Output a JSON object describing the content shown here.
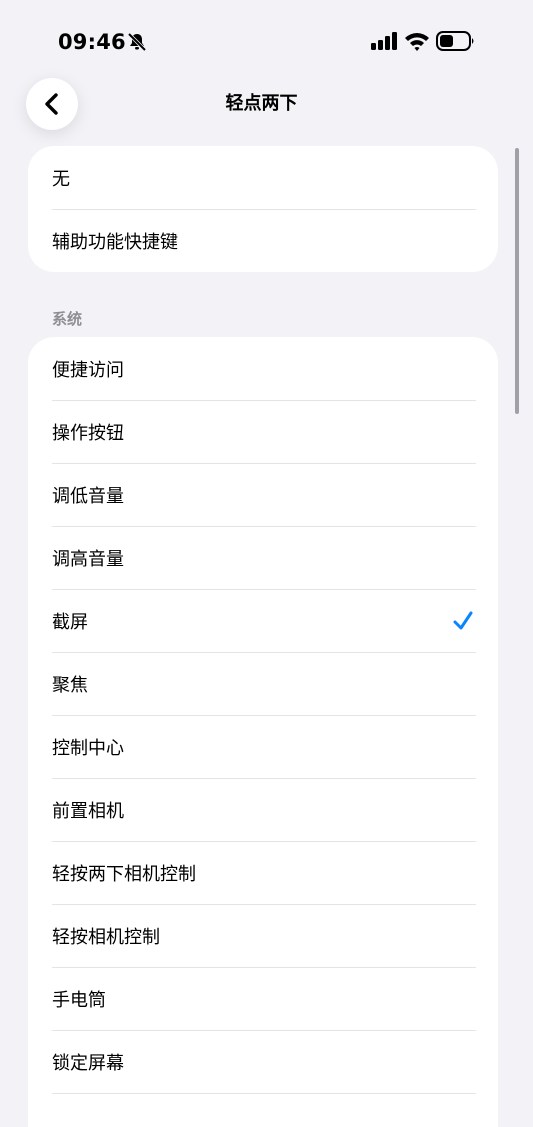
{
  "status_bar": {
    "time": "09:46",
    "icons": [
      "bell-slash-icon",
      "signal-icon",
      "wifi-icon",
      "battery-icon"
    ]
  },
  "nav": {
    "back_icon": "chevron-left-icon",
    "title": "轻点两下"
  },
  "top_group": {
    "items": [
      {
        "label": "无"
      },
      {
        "label": "辅助功能快捷键"
      }
    ]
  },
  "system_section": {
    "header": "系统",
    "items": [
      {
        "label": "便捷访问"
      },
      {
        "label": "操作按钮"
      },
      {
        "label": "调低音量"
      },
      {
        "label": "调高音量"
      },
      {
        "label": "截屏",
        "selected": true
      },
      {
        "label": "聚焦"
      },
      {
        "label": "控制中心"
      },
      {
        "label": "前置相机"
      },
      {
        "label": "轻按两下相机控制"
      },
      {
        "label": "轻按相机控制"
      },
      {
        "label": "手电筒"
      },
      {
        "label": "锁定屏幕"
      },
      {
        "label": ""
      }
    ]
  },
  "colors": {
    "background": "#f2f2f7",
    "card": "#ffffff",
    "accent": "#0a84ff",
    "separator": "#e3e3e8",
    "secondary_text": "#8e8e93"
  }
}
